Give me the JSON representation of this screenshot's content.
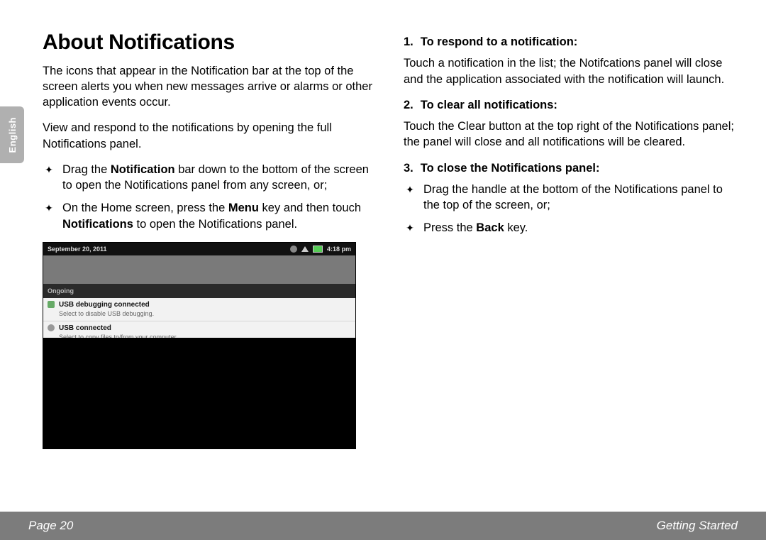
{
  "sideTab": "English",
  "title": "About Notifications",
  "col1": {
    "p1": "The icons that appear in the Notification bar at the top of the screen alerts you when new messages arrive or alarms or other application events occur.",
    "p2": "View and respond to the notifications by opening the full Notifications panel.",
    "b1_pre": "Drag the ",
    "b1_bold": "Notification",
    "b1_post": " bar down to the bottom of the screen to open the Notifications panel from any screen, or;",
    "b2_pre": "On the Home screen, press the ",
    "b2_bold1": "Menu",
    "b2_mid": " key and then touch ",
    "b2_bold2": "Notifications",
    "b2_post": " to open the Notifications panel."
  },
  "shot": {
    "date": "September 20, 2011",
    "time": "4:18 pm",
    "ongoing": "Ongoing",
    "r1t": "USB debugging connected",
    "r1s": "Select to disable USB debugging.",
    "r2t": "USB connected",
    "r2s": "Select to copy files to/from your computer."
  },
  "col2": {
    "h1n": "1.",
    "h1": "To respond to a notification:",
    "p1": "Touch a notification in the list; the Notifcations panel will close and the application associated with the notification will launch.",
    "h2n": "2.",
    "h2": "To clear all notifications:",
    "p2": "Touch the Clear button at the top right of the Notifications panel; the panel will close and all notifications will be cleared.",
    "h3n": "3.",
    "h3": "To close the Notifications panel:",
    "b1": "Drag the handle at the bottom of the Notifications panel to the top of the screen, or;",
    "b2_pre": "Press the ",
    "b2_bold": "Back",
    "b2_post": " key."
  },
  "footer": {
    "left": "Page 20",
    "right": "Getting Started"
  }
}
